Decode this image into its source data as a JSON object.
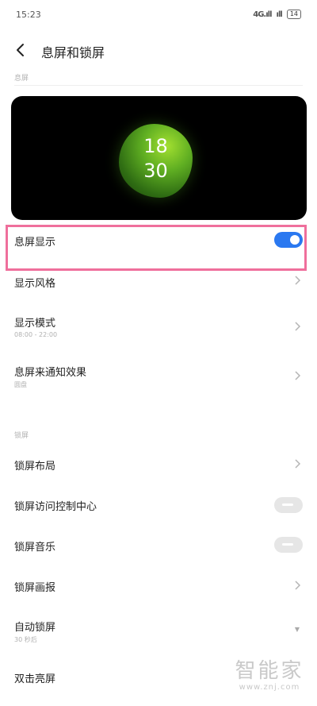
{
  "status_bar": {
    "time": "15:23",
    "signal_1": "4G.ıll",
    "signal_2": "ıll",
    "battery": "14"
  },
  "header": {
    "title": "息屏和锁屏"
  },
  "aod_section": {
    "caption": "息屏",
    "preview_clock": {
      "hour": "18",
      "minute": "30"
    },
    "items": [
      {
        "title": "息屏显示",
        "toggle": "on"
      },
      {
        "title": "显示风格"
      },
      {
        "title": "显示模式",
        "subtitle": "08:00 - 22:00"
      },
      {
        "title": "息屏来通知效果",
        "subtitle": "圆盘"
      }
    ]
  },
  "lock_section": {
    "caption": "锁屏",
    "items": [
      {
        "title": "锁屏布局"
      },
      {
        "title": "锁屏访问控制中心",
        "toggle": "off"
      },
      {
        "title": "锁屏音乐",
        "toggle": "off"
      },
      {
        "title": "锁屏画报"
      },
      {
        "title": "自动锁屏",
        "subtitle": "30 秒后"
      },
      {
        "title": "双击亮屏"
      }
    ]
  },
  "watermark": {
    "text": "智能家",
    "url": "www.znj.com"
  },
  "colors": {
    "accent": "#2a78f0",
    "highlight": "#ef6f9c"
  }
}
